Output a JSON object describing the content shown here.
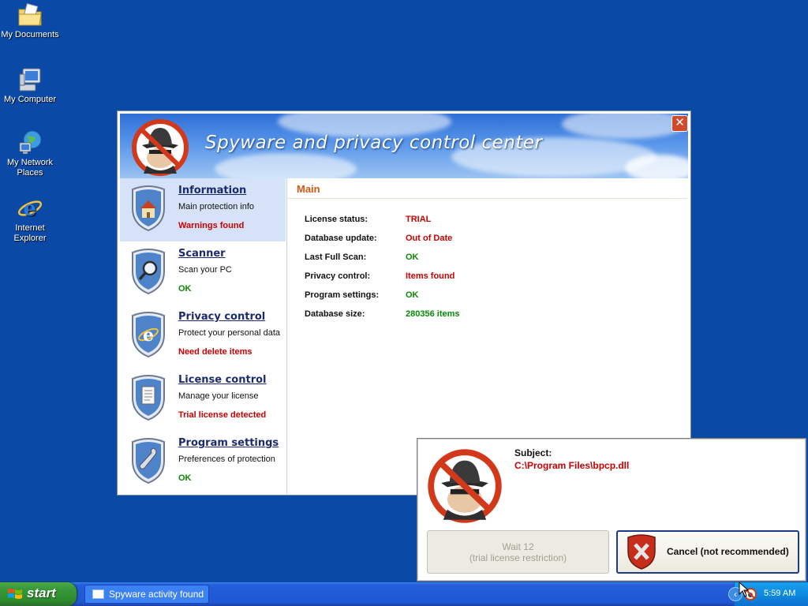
{
  "desktop": {
    "icons": [
      {
        "label": "My Documents",
        "icon": "folder-documents-icon"
      },
      {
        "label": "My Computer",
        "icon": "computer-icon"
      },
      {
        "label": "My Network Places",
        "icon": "network-places-icon"
      },
      {
        "label": "Internet Explorer",
        "icon": "internet-explorer-icon"
      }
    ]
  },
  "window": {
    "title": "Spyware and privacy control center",
    "close_label": "✕",
    "nav": [
      {
        "title": "Information",
        "subtitle": "Main protection info",
        "status": "Warnings found",
        "status_color": "#cc0000",
        "icon": "house-icon"
      },
      {
        "title": "Scanner",
        "subtitle": "Scan your PC",
        "status": "OK",
        "status_color": "#078a07",
        "icon": "magnifier-icon"
      },
      {
        "title": "Privacy control",
        "subtitle": "Protect your personal data",
        "status": "Need delete items",
        "status_color": "#cc0000",
        "icon": "internet-explorer-icon"
      },
      {
        "title": "License control",
        "subtitle": "Manage your license",
        "status": "Trial license detected",
        "status_color": "#cc0000",
        "icon": "document-icon"
      },
      {
        "title": "Program settings",
        "subtitle": "Preferences of protection",
        "status": "OK",
        "status_color": "#078a07",
        "icon": "wrench-icon"
      }
    ],
    "content": {
      "heading": "Main",
      "rows": [
        {
          "key": "License status:",
          "value": "TRIAL",
          "color": "#cc0000"
        },
        {
          "key": "Database update:",
          "value": "Out of Date",
          "color": "#cc0000"
        },
        {
          "key": "Last Full Scan:",
          "value": "OK",
          "color": "#078a07"
        },
        {
          "key": "Privacy control:",
          "value": "Items found",
          "color": "#cc0000"
        },
        {
          "key": "Program settings:",
          "value": "OK",
          "color": "#078a07"
        },
        {
          "key": "Database size:",
          "value": "280356 items",
          "color": "#078a07"
        }
      ]
    }
  },
  "popup": {
    "subject_label": "Subject:",
    "path": "C:\\Program Files\\bpcp.dll",
    "wait_line1": "Wait 12",
    "wait_line2": "(trial license restriction)",
    "cancel_label": "Cancel (not recommended)"
  },
  "taskbar": {
    "start_label": "start",
    "task_label": "Spyware activity found",
    "clock": "5:59 AM",
    "chevron": "‹"
  },
  "colors": {
    "desktop": "#0a4aa6",
    "alert_red": "#cc0000",
    "ok_green": "#078a07",
    "heading_orange": "#d35a11"
  }
}
